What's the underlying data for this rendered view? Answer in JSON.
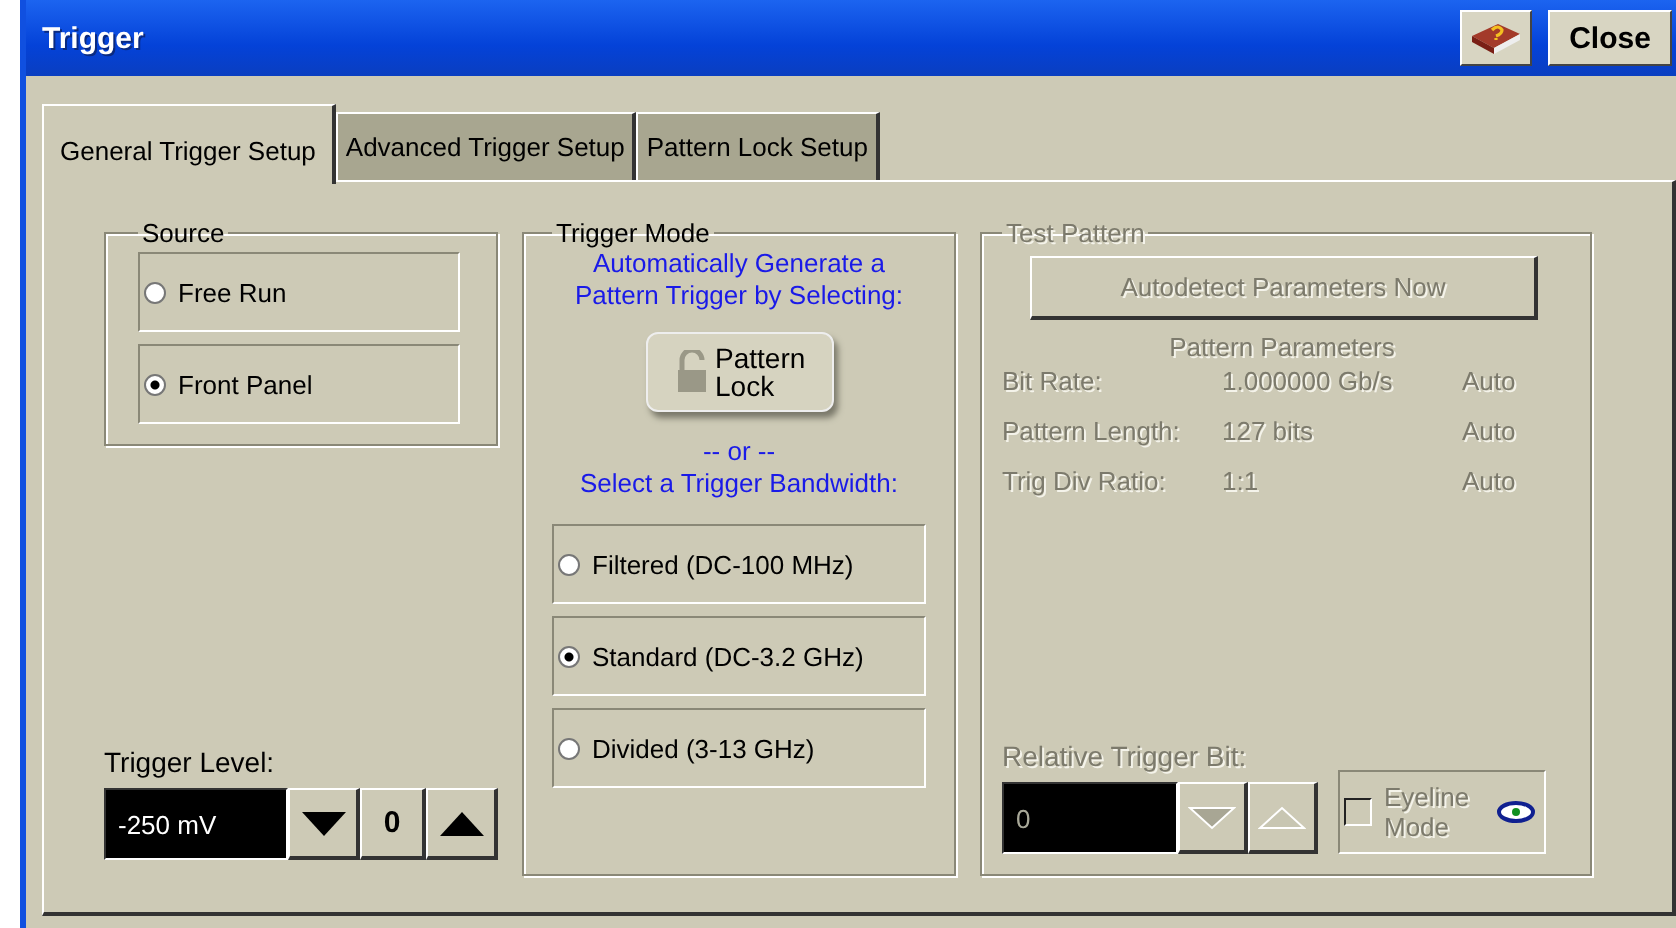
{
  "window": {
    "title": "Trigger",
    "close_button": "Close"
  },
  "tabs": [
    {
      "label": "General Trigger Setup",
      "selected": true
    },
    {
      "label": "Advanced Trigger Setup",
      "selected": false
    },
    {
      "label": "Pattern Lock Setup",
      "selected": false
    }
  ],
  "source": {
    "title": "Source",
    "options": [
      {
        "label": "Free Run",
        "selected": false
      },
      {
        "label": "Front Panel",
        "selected": true
      }
    ]
  },
  "trigger_level": {
    "label": "Trigger Level:",
    "value": "-250 mV",
    "zero_button": "0"
  },
  "trigger_mode": {
    "title": "Trigger Mode",
    "prompt": "Automatically Generate a Pattern Trigger by Selecting:",
    "lock_button": "Pattern Lock",
    "or_text": "-- or --",
    "bandwidth_prompt": "Select a Trigger Bandwidth:",
    "options": [
      {
        "label": "Filtered (DC-100 MHz)",
        "selected": false
      },
      {
        "label": "Standard (DC-3.2 GHz)",
        "selected": true
      },
      {
        "label": "Divided (3-13 GHz)",
        "selected": false
      }
    ]
  },
  "test_pattern": {
    "title": "Test Pattern",
    "disabled": true,
    "autodetect_button": "Autodetect Parameters Now",
    "parameters_heading": "Pattern Parameters",
    "parameters": [
      {
        "label": "Bit Rate:",
        "value": "1.000000 Gb/s",
        "mode": "Auto"
      },
      {
        "label": "Pattern Length:",
        "value": "127 bits",
        "mode": "Auto"
      },
      {
        "label": "Trig Div Ratio:",
        "value": "1:1",
        "mode": "Auto"
      }
    ],
    "relative_trigger_bit": {
      "label": "Relative Trigger Bit:",
      "value": "0"
    },
    "eyeline": {
      "label": "Eyeline Mode",
      "checked": false
    }
  }
}
